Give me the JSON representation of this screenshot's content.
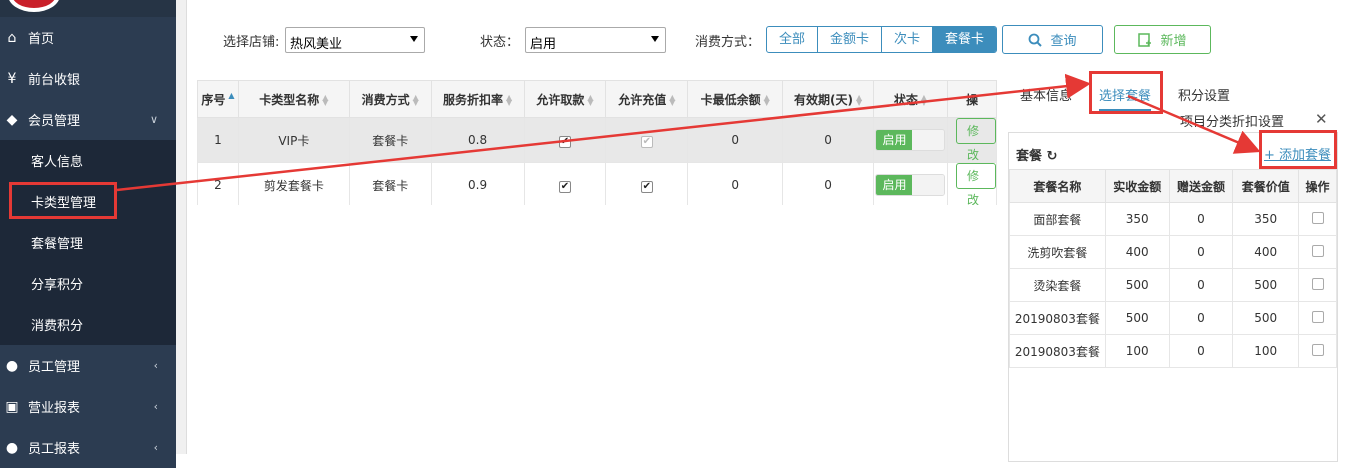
{
  "sidebar": {
    "items": [
      {
        "label": "首页",
        "icon": "home-icon",
        "glyph": "⌂",
        "arrow": ""
      },
      {
        "label": "前台收银",
        "icon": "yen-icon",
        "glyph": "¥",
        "arrow": ""
      },
      {
        "label": "会员管理",
        "icon": "diamond-icon",
        "glyph": "◆",
        "arrow": "∨"
      },
      {
        "label": "客人信息",
        "icon": "",
        "glyph": "",
        "arrow": ""
      },
      {
        "label": "卡类型管理",
        "icon": "",
        "glyph": "",
        "arrow": ""
      },
      {
        "label": "套餐管理",
        "icon": "",
        "glyph": "",
        "arrow": ""
      },
      {
        "label": "分享积分",
        "icon": "",
        "glyph": "",
        "arrow": ""
      },
      {
        "label": "消费积分",
        "icon": "",
        "glyph": "",
        "arrow": ""
      },
      {
        "label": "员工管理",
        "icon": "user-icon",
        "glyph": "●",
        "arrow": "‹"
      },
      {
        "label": "营业报表",
        "icon": "monitor-icon",
        "glyph": "▣",
        "arrow": "‹"
      },
      {
        "label": "员工报表",
        "icon": "user-chart-icon",
        "glyph": "●",
        "arrow": "‹"
      }
    ]
  },
  "filters": {
    "store_label": "选择店铺:",
    "store_value": "热风美业",
    "status_label": "状态：",
    "status_value": "启用",
    "method_label": "消费方式：",
    "methods": [
      "全部",
      "金额卡",
      "次卡",
      "套餐卡"
    ],
    "query_label": "查询",
    "add_label": "新增"
  },
  "table": {
    "headers": [
      "序号",
      "卡类型名称",
      "消费方式",
      "服务折扣率",
      "允许取款",
      "允许充值",
      "卡最低余额",
      "有效期(天)",
      "状态",
      "操"
    ],
    "rows": [
      {
        "no": "1",
        "name": "VIP卡",
        "method": "套餐卡",
        "discount": "0.8",
        "withdraw": "✔",
        "recharge": "✔",
        "min_balance": "0",
        "validity": "0",
        "status": "启用",
        "action": "修改"
      },
      {
        "no": "2",
        "name": "剪发套餐卡",
        "method": "套餐卡",
        "discount": "0.9",
        "withdraw": "✔",
        "recharge": "✔",
        "min_balance": "0",
        "validity": "0",
        "status": "启用",
        "action": "修改"
      }
    ]
  },
  "panel": {
    "tabs": [
      "基本信息",
      "选择套餐",
      "积分设置",
      "项目分类折扣设置"
    ],
    "title": "套餐",
    "refresh_glyph": "↻",
    "add_label": "+ 添加套餐",
    "close_glyph": "✕",
    "headers": [
      "套餐名称",
      "实收金额",
      "赠送金额",
      "套餐价值",
      "操作"
    ],
    "rows": [
      {
        "name": "面部套餐",
        "paid": "350",
        "gift": "0",
        "value": "350"
      },
      {
        "name": "洗剪吹套餐",
        "paid": "400",
        "gift": "0",
        "value": "400"
      },
      {
        "name": "烫染套餐",
        "paid": "500",
        "gift": "0",
        "value": "500"
      },
      {
        "name": "20190803套餐",
        "paid": "500",
        "gift": "0",
        "value": "500"
      },
      {
        "name": "20190803套餐",
        "paid": "100",
        "gift": "0",
        "value": "100"
      }
    ]
  },
  "colors": {
    "accent": "#3c8dbc",
    "success": "#5cb85c",
    "annotation": "#e53935",
    "sidebar": "#263445"
  }
}
